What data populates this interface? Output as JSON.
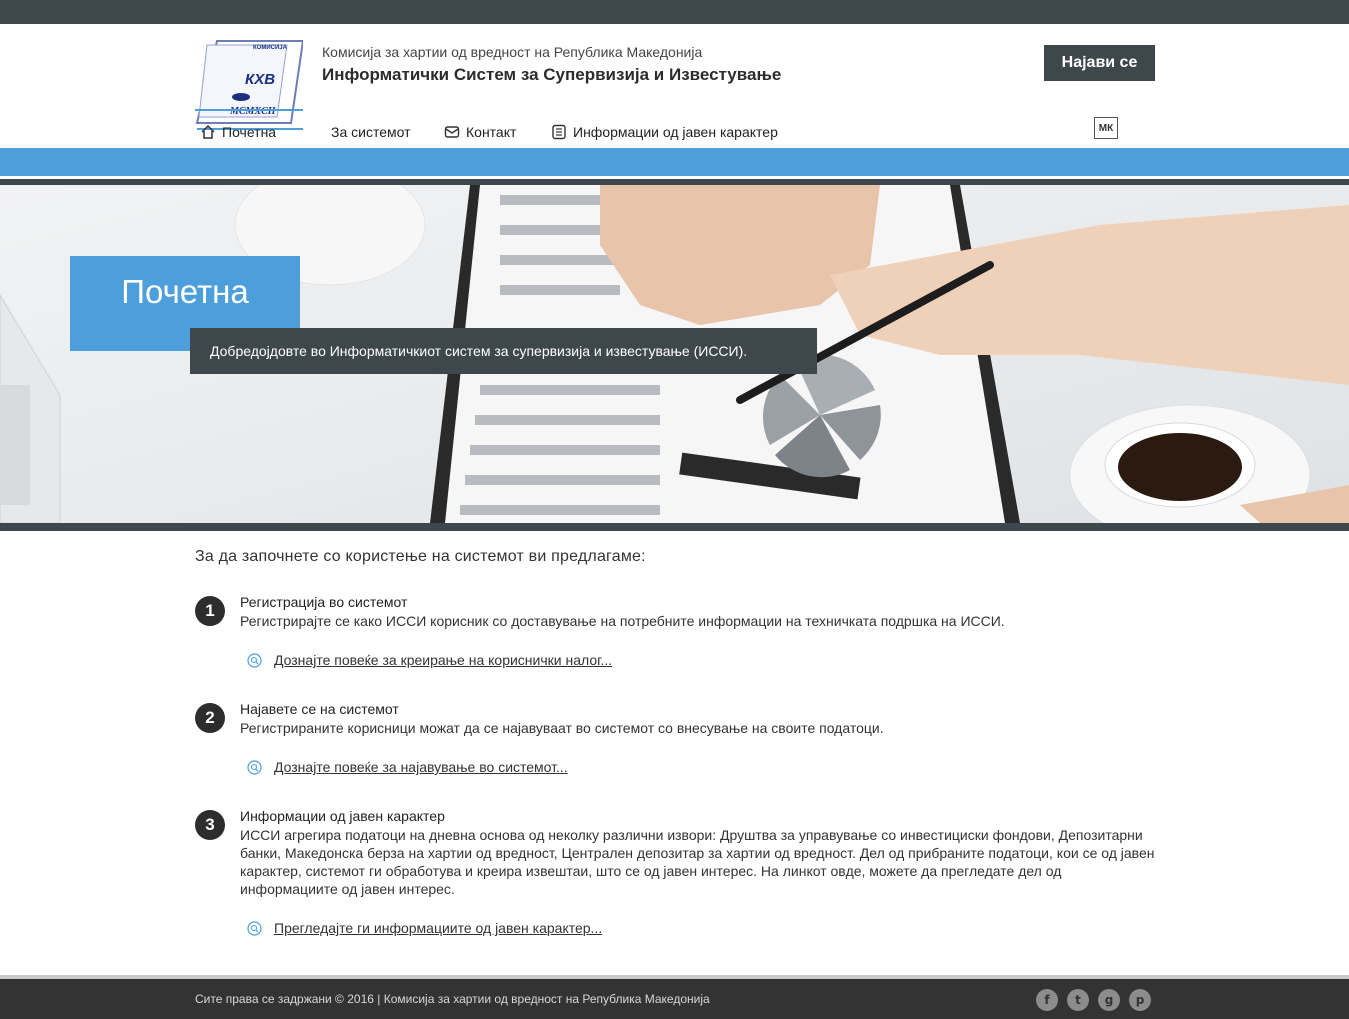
{
  "header": {
    "logo_text_top": "КХВ",
    "logo_text_bottom": "MCMXCII",
    "logo_text_side": "КОМИСИЈА",
    "org_name": "Комисија за хартии од вредност на Република Македонија",
    "system_name": "Информатички Систем за Супервизија и Известување",
    "login_label": "Најави се"
  },
  "nav": {
    "items": [
      {
        "label": "Почетна",
        "icon": "home-icon"
      },
      {
        "label": "За системот",
        "icon": ""
      },
      {
        "label": "Контакт",
        "icon": "mail-icon"
      },
      {
        "label": "Информации од јавен карактер",
        "icon": "document-icon"
      }
    ],
    "lang": "МК"
  },
  "hero": {
    "title": "Почетна",
    "subtitle": "Добредојдовте во Информатичкиот систем за супервизија и известување (ИССИ)."
  },
  "main": {
    "intro": "За да започнете со користење на системот ви предлагаме:",
    "steps": [
      {
        "number": "1",
        "title": "Регистрација во системот",
        "text": "Регистрирајте се како ИССИ корисник со доставување на потребните информации на техничката подршка на ИССИ.",
        "link": "Дознајте повеќе за креирање на кориснички налог..."
      },
      {
        "number": "2",
        "title": "Најавете се на системот",
        "text": "Регистрираните корисници можат да се најавуваат во системот со внесување на своите податоци.",
        "link": "Дознајте повеќе за најавување во системот..."
      },
      {
        "number": "3",
        "title": "Информации од јавен карактер",
        "text": "ИССИ агрегира податоци на дневна основа од неколку различни извори: Друштва за управување со инвестициски фондови, Депозитарни банки, Македонска берза на хартии од вредност, Централен депозитар за хартии од вредност. Дел од прибраните податоци, кои се од јавен карактер, системот ги обработува и креира извештаи, што се од јавен интерес. На линкот овде, можете да прегледате дел од информациите од јавен интерес.",
        "link": "Прегледајте ги информациите од јавен карактер..."
      }
    ]
  },
  "footer": {
    "copyright": "Сите права се задржани © 2016 | Комисија за хартии од вредност на Република Македонија",
    "social": [
      {
        "icon": "facebook-icon",
        "glyph": "f"
      },
      {
        "icon": "twitter-icon",
        "glyph": "t"
      },
      {
        "icon": "google-plus-icon",
        "glyph": "g"
      },
      {
        "icon": "pinterest-icon",
        "glyph": "p"
      }
    ]
  },
  "colors": {
    "dark": "#3e474c",
    "accent": "#4d9fdb",
    "footer": "#333333"
  }
}
